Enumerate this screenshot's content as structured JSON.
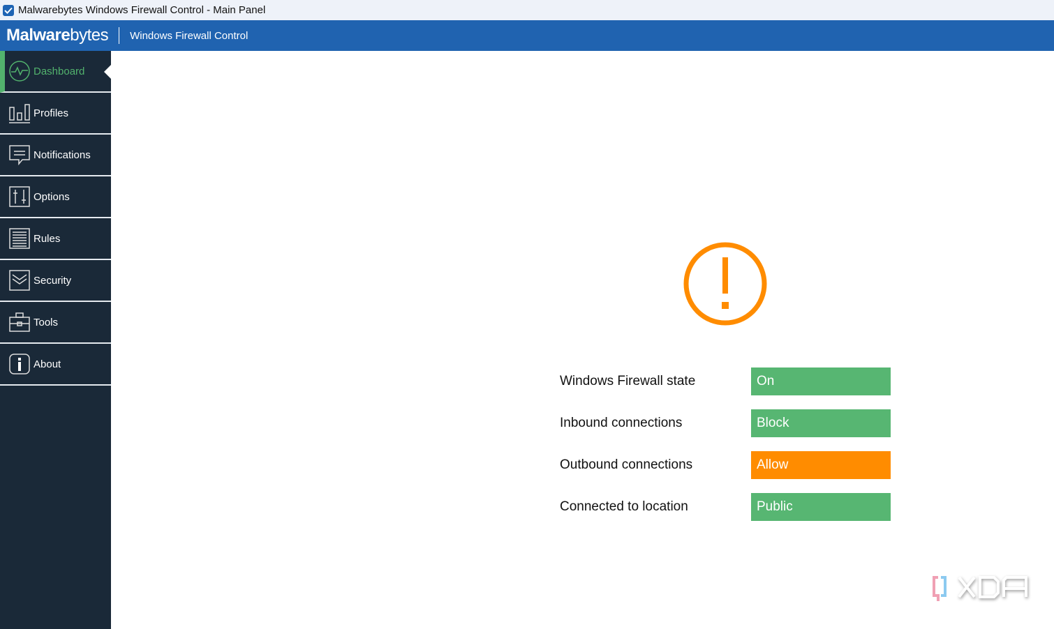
{
  "window": {
    "title": "Malwarebytes Windows Firewall Control - Main Panel"
  },
  "header": {
    "brand": "Malwarebytes",
    "app_name": "Windows Firewall Control"
  },
  "sidebar": {
    "items": [
      {
        "label": "Dashboard",
        "icon": "pulse-icon",
        "active": true
      },
      {
        "label": "Profiles",
        "icon": "bars-icon"
      },
      {
        "label": "Notifications",
        "icon": "message-icon"
      },
      {
        "label": "Options",
        "icon": "sliders-icon"
      },
      {
        "label": "Rules",
        "icon": "list-icon"
      },
      {
        "label": "Security",
        "icon": "shield-chevron-icon"
      },
      {
        "label": "Tools",
        "icon": "toolbox-icon"
      },
      {
        "label": "About",
        "icon": "info-icon"
      }
    ]
  },
  "status": [
    {
      "label": "Windows Firewall state",
      "value": "On",
      "color": "#57b672"
    },
    {
      "label": "Inbound connections",
      "value": "Block",
      "color": "#57b672"
    },
    {
      "label": "Outbound connections",
      "value": "Allow",
      "color": "#ff8c00"
    },
    {
      "label": "Connected to location",
      "value": "Public",
      "color": "#57b672"
    }
  ],
  "watermark": "XDA",
  "colors": {
    "accent": "#2063b0",
    "warning": "#ff8c00",
    "ok": "#57b672",
    "sidebar": "#1a2938"
  }
}
